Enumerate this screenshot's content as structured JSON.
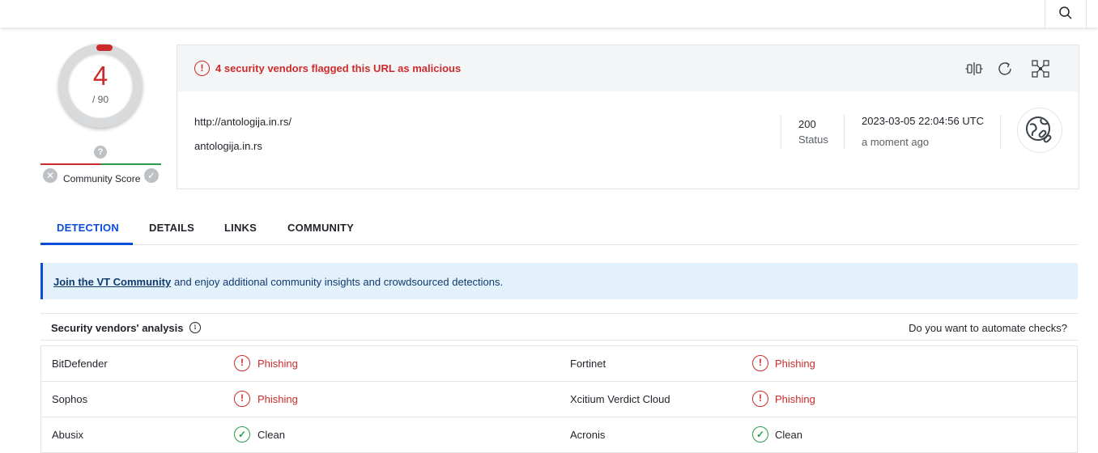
{
  "header": {
    "search_icon": "search-icon"
  },
  "score": {
    "detections": "4",
    "total": "/ 90",
    "community_label": "Community Score",
    "question_mark": "?",
    "x_mark": "✕",
    "check_mark": "✓"
  },
  "summary": {
    "alert_text": "4 security vendors flagged this URL as malicious",
    "alert_glyph": "!",
    "url": "http://antologija.in.rs/",
    "domain": "antologija.in.rs",
    "status_code": "200",
    "status_label": "Status",
    "datetime": "2023-03-05 22:04:56 UTC",
    "relative_time": "a moment ago",
    "icons": [
      "compare-icon",
      "reanalyze-icon",
      "qr-code-icon",
      "globe-link-icon"
    ]
  },
  "tabs": [
    {
      "label": "DETECTION",
      "active": true
    },
    {
      "label": "DETAILS",
      "active": false
    },
    {
      "label": "LINKS",
      "active": false
    },
    {
      "label": "COMMUNITY",
      "active": false
    }
  ],
  "banner": {
    "link": "Join the VT Community",
    "text": "and enjoy additional community insights and crowdsourced detections."
  },
  "vendors": {
    "title": "Security vendors' analysis",
    "info_glyph": "i",
    "automate": "Do you want to automate checks?",
    "rows": [
      {
        "left_name": "BitDefender",
        "left_result": "Phishing",
        "left_icon": "!",
        "right_name": "Fortinet",
        "right_result": "Phishing",
        "right_icon": "!"
      },
      {
        "left_name": "Sophos",
        "left_result": "Phishing",
        "left_icon": "!",
        "right_name": "Xcitium Verdict Cloud",
        "right_result": "Phishing",
        "right_icon": "!"
      },
      {
        "left_name": "Abusix",
        "left_result": "Clean",
        "left_icon": "✓",
        "right_name": "Acronis",
        "right_result": "Clean",
        "right_icon": "✓"
      }
    ]
  },
  "colors": {
    "malicious": "#cc2b2b",
    "clean": "#2d9b4e",
    "accent": "#0b4dda",
    "banner_bg": "#e2f1fc"
  }
}
